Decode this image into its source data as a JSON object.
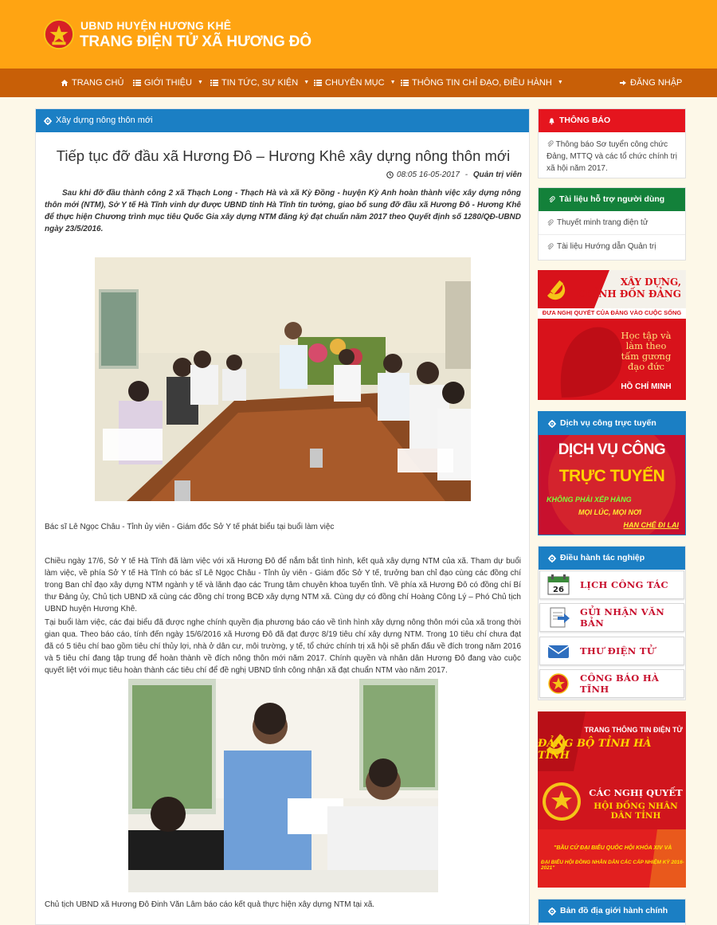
{
  "site": {
    "line1": "UBND HUYỆN HƯƠNG KHÊ",
    "line2": "TRANG ĐIỆN TỬ XÃ HƯƠNG ĐÔ"
  },
  "nav": {
    "home": "TRANG CHỦ",
    "intro": "GIỚI THIỆU",
    "news": "TIN TỨC, SỰ KIỆN",
    "topics": "CHUYÊN MỤC",
    "directives": "THÔNG TIN CHỈ ĐẠO, ĐIỀU HÀNH",
    "login": "ĐĂNG NHẬP"
  },
  "article": {
    "section": "Xây dựng nông thôn mới",
    "title": "Tiếp tục đỡ đầu xã Hương Đô – Hương Khê xây dựng nông thôn mới",
    "time": "08:05 16-05-2017",
    "separator": " - ",
    "author": "Quản trị viên",
    "lead": "Sau khi đỡ đầu thành công 2 xã Thạch Long - Thạch Hà và xã Kỳ Đồng - huyện Kỳ Anh hoàn thành việc xây dựng nông thôn mới (NTM), Sở Y tế Hà Tĩnh vinh dự được UBND tỉnh Hà Tĩnh tin tưởng, giao bổ sung đỡ đầu xã Hương Đô - Hương Khê để thực hiện Chương trình mục tiêu Quốc Gia xây dựng NTM đăng ký đạt chuẩn năm 2017 theo Quyết định số 1280/QĐ-UBND ngày 23/5/2016.",
    "caption1": "Bác sĩ Lê Ngọc Châu - Tỉnh ủy viên - Giám đốc Sở Y tế phát biểu tại buổi làm việc",
    "para1": "Chiều ngày 17/6, Sở Y tế Hà Tĩnh đã làm việc với xã Hương Đô để nắm bắt tình hình, kết quả xây dựng NTM của xã. Tham dự buổi làm việc, về phía Sở Y tế Hà Tĩnh có bác sĩ Lê Ngọc Châu - Tỉnh ủy viên - Giám đốc Sở Y tế, trưởng ban chỉ đạo cùng các đồng chí trong Ban chỉ đạo xây dựng NTM ngành y tế và lãnh đạo các Trung tâm chuyên khoa tuyến tỉnh. Về phía xã Hương Đô có đồng chí Bí thư Đảng ủy, Chủ tịch UBND xã cùng các đồng chí trong BCĐ xây dựng NTM xã. Cùng dự có đồng chí Hoàng Công Lý – Phó Chủ tịch UBND huyện Hương Khê.",
    "para2": "Tại buổi làm việc, các đại biểu đã được nghe chính quyền địa phương báo cáo về tình hình xây dựng nông thôn mới của xã trong thời gian qua. Theo báo cáo, tính đến ngày 15/6/2016 xã Hương Đô đã đạt được 8/19 tiêu chí xây dựng NTM. Trong 10 tiêu chí chưa đạt đã có 5 tiêu chí bao gồm tiêu chí thủy lợi, nhà ở dân cư, môi trường, y tế, tổ chức chính trị xã hội sẽ phấn đấu về đích trong năm 2016 và 5 tiêu chí đang tập trung để hoàn thành về đích nông thôn mới năm 2017. Chính quyền và nhân dân Hương Đô đang vào cuộc quyết liệt với mục tiêu hoàn thành các tiêu chí để đề nghị UBND tỉnh công nhận xã đạt chuẩn NTM vào năm 2017.",
    "caption2": "Chủ tịch UBND xã Hương Đô Đinh Văn Lâm báo cáo kết quả thực hiện xây dựng NTM tại xã."
  },
  "sidebar": {
    "notice": {
      "title": "THÔNG BÁO",
      "item": "Thông báo Sơ tuyển công chức Đảng, MTTQ và các tổ chức chính trị xã hội năm 2017."
    },
    "docs": {
      "title": "Tài liệu hỗ trợ người dùng",
      "items": [
        "Thuyết minh trang điện tử",
        "Tài liệu Hướng dẫn Quản trị"
      ]
    },
    "banner_party": {
      "line1": "XÂY DỰNG,",
      "line2": "CHỈNH ĐỐN ĐẢNG",
      "ribbon": "ĐƯA NGHỊ QUYẾT CỦA ĐẢNG VÀO CUỘC SỐNG",
      "l1": "Học tập và",
      "l2": "làm theo",
      "l3": "tấm gương",
      "l4": "đạo đức",
      "name": "HỒ CHÍ MINH"
    },
    "online": {
      "title": "Dịch vụ công trực tuyến",
      "line1": "DỊCH VỤ CÔNG",
      "line2": "TRỰC TUYẾN",
      "line3": "KHÔNG PHẢI XẾP HÀNG",
      "line4": "MỌI LÚC, MỌI NƠI",
      "line5": "HẠN CHẾ ĐI LẠI"
    },
    "ops": {
      "title": "Điều hành tác nghiệp",
      "calendar_day": "26",
      "items": [
        "LỊCH CÔNG TÁC",
        "GỬI NHẬN VĂN BẢN",
        "THƯ ĐIỆN TỬ",
        "CÔNG BÁO HÀ TĨNH"
      ]
    },
    "banner_portal": {
      "line1": "TRANG THÔNG TIN ĐIỆN TỬ",
      "line2": "ĐẢNG BỘ TỈNH HÀ TĨNH"
    },
    "banner_resolutions": {
      "line1": "CÁC NGHỊ QUYẾT",
      "line2": "HỘI ĐỒNG NHÂN DÂN TỈNH"
    },
    "banner_election": {
      "line1": "\"BẦU CỬ ĐẠI BIỂU QUỐC HỘI KHÓA XIV VÀ",
      "line2": "ĐẠI BIỂU HỘI ĐỒNG NHÂN DÂN CÁC CẤP NHIỆM KỲ 2016-2021\""
    },
    "map": {
      "title": "Bản đồ địa giới hành chính"
    }
  },
  "colors": {
    "header": "#ffa412",
    "nav": "#c85f07",
    "panel_blue": "#1b7fc4",
    "notice_red": "#e5151e",
    "docs_green": "#13813a",
    "accent_red": "#c8102e"
  },
  "icons": [
    "home-icon",
    "list-icon",
    "cog-icon",
    "clock-icon",
    "bell-icon",
    "paperclip-icon",
    "signin-icon"
  ]
}
